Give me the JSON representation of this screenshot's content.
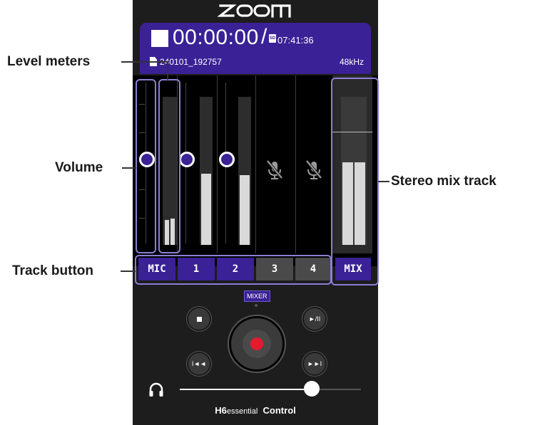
{
  "app": {
    "logo": "ZOOM",
    "name_bold": "H6",
    "name_small": "essential",
    "name_suffix": "Control"
  },
  "status": {
    "time": "00:00:00",
    "separator": "/",
    "sd_label": "SD",
    "remaining": "07:41:36",
    "filename": "240101_192757",
    "sample_rate": "48kHz"
  },
  "tracks": [
    {
      "label": "MIC",
      "state": "on",
      "volume": 0.48,
      "level_left": 0.17,
      "level_right": 0.18,
      "muted": false
    },
    {
      "label": "1",
      "state": "on",
      "volume": 0.48,
      "level": 0.48,
      "muted": false
    },
    {
      "label": "2",
      "state": "on",
      "volume": 0.48,
      "level": 0.47,
      "muted": false
    },
    {
      "label": "3",
      "state": "off",
      "muted": true,
      "icon": "mic-muted-icon"
    },
    {
      "label": "4",
      "state": "off",
      "muted": true,
      "icon": "mic-muted-icon"
    }
  ],
  "mix": {
    "label": "MIX",
    "level_left": 0.56,
    "level_right": 0.56
  },
  "mixer_tab": "MIXER",
  "transport": {
    "stop": "stop-icon",
    "play_pause": "play-pause-icon",
    "record": "record-icon",
    "rewind": "rewind-icon",
    "forward": "fast-forward-icon"
  },
  "headphone_volume": 0.73,
  "callouts": {
    "level_meters": "Level meters",
    "volume": "Volume",
    "track_button": "Track button",
    "stereo_mix": "Stereo mix track"
  },
  "colors": {
    "accent": "#3a2196",
    "record": "#e51a2e",
    "callout": "#8b7fd6"
  }
}
